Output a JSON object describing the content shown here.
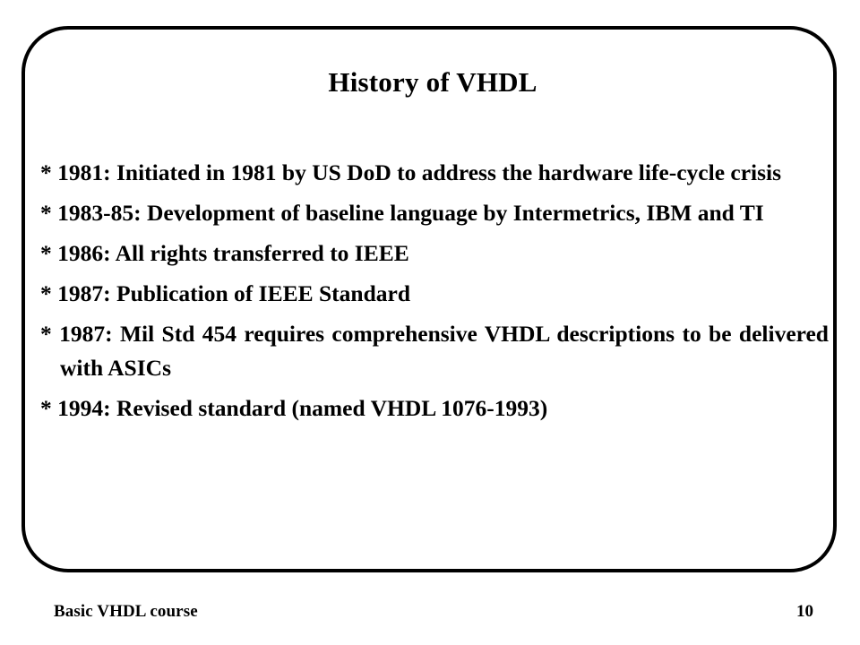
{
  "slide": {
    "title": "History of VHDL",
    "bullet_marker": "*",
    "bullets": [
      {
        "text": "* 1981: Initiated  in 1981 by  US DoD  to  address  the  hardware life-cycle crisis",
        "justified": true
      },
      {
        "text": "* 1983-85: Development  of  baseline  language  by Intermetrics, IBM and TI",
        "justified": true
      },
      {
        "text": "* 1986: All rights transferred to IEEE",
        "justified": false
      },
      {
        "text": "* 1987: Publication of IEEE Standard",
        "justified": false
      },
      {
        "text": "* 1987: Mil Std 454 requires comprehensive VHDL descriptions to be delivered with ASICs",
        "justified": true
      },
      {
        "text": "* 1994: Revised standard (named VHDL 1076-1993)",
        "justified": false
      }
    ],
    "footer": {
      "course_name": "Basic VHDL course",
      "page_number": "10"
    },
    "colors": {
      "border": "#000000",
      "text": "#000000",
      "background": "#ffffff"
    }
  }
}
